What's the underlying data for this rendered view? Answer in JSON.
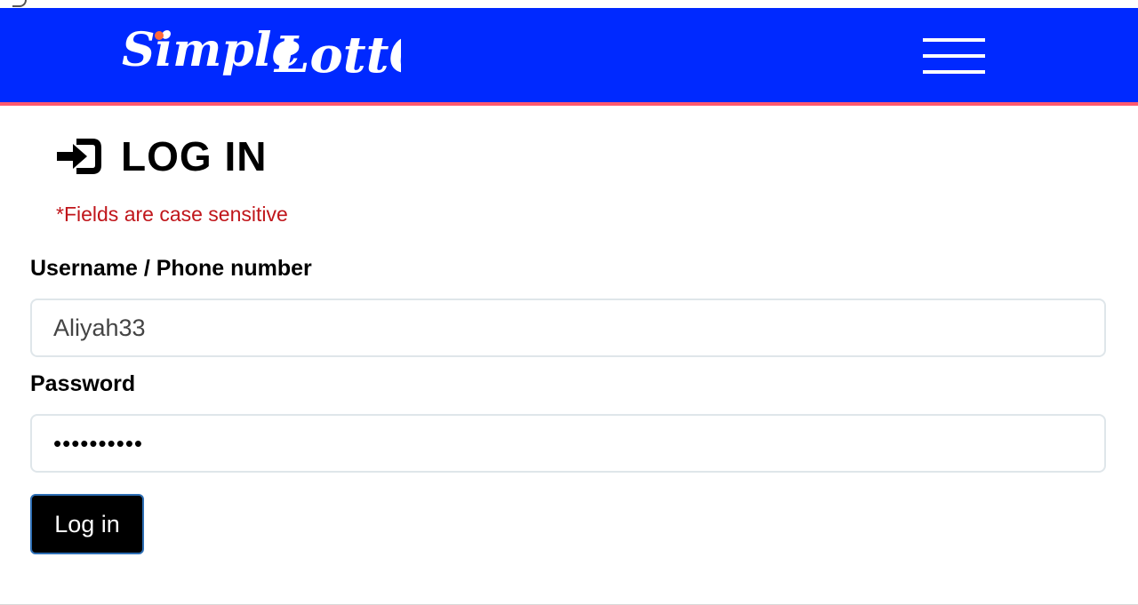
{
  "header": {
    "logo_text_part1": "Simple",
    "logo_text_part2": "LottO",
    "brand_color": "#0029ff",
    "accent_color": "#ff5a6e",
    "menu_icon": "hamburger-menu-icon"
  },
  "login": {
    "title_icon": "sign-in-icon",
    "title": "LOG IN",
    "note": "*Fields are case sensitive",
    "username_label": "Username / Phone number",
    "username_value": "Aliyah33",
    "password_label": "Password",
    "password_value": "••••••••••",
    "submit_label": "Log in"
  }
}
